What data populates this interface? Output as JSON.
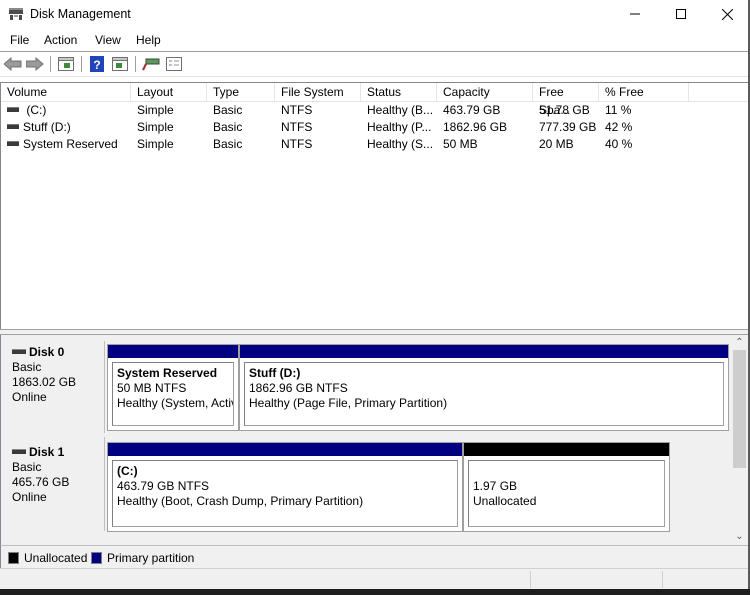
{
  "window": {
    "title": "Disk Management",
    "minimize": "minimize",
    "maximize": "maximize",
    "close": "close"
  },
  "menu": {
    "items": [
      {
        "label": "File"
      },
      {
        "label": "Action"
      },
      {
        "label": "View"
      },
      {
        "label": "Help"
      }
    ]
  },
  "toolbar": {
    "buttons": [
      "back-icon",
      "forward-icon",
      "show-hide-console-tree-icon",
      "help-icon",
      "show-hide-action-pane-icon",
      "connect-drive-icon",
      "properties-icon"
    ]
  },
  "volume_list": {
    "columns": [
      "Volume",
      "Layout",
      "Type",
      "File System",
      "Status",
      "Capacity",
      "Free Spa...",
      "% Free"
    ],
    "rows": [
      {
        "volume": " (C:)",
        "layout": "Simple",
        "type": "Basic",
        "fs": "NTFS",
        "status": "Healthy (B...",
        "capacity": "463.79 GB",
        "free": "51.78 GB",
        "pct": "11 %"
      },
      {
        "volume": "Stuff (D:)",
        "layout": "Simple",
        "type": "Basic",
        "fs": "NTFS",
        "status": "Healthy (P...",
        "capacity": "1862.96 GB",
        "free": "777.39 GB",
        "pct": "42 %"
      },
      {
        "volume": "System Reserved",
        "layout": "Simple",
        "type": "Basic",
        "fs": "NTFS",
        "status": "Healthy (S...",
        "capacity": "50 MB",
        "free": "20 MB",
        "pct": "40 %"
      }
    ]
  },
  "disks": [
    {
      "name": "Disk 0",
      "type": "Basic",
      "size": "1863.02 GB",
      "state": "Online",
      "partitions": [
        {
          "title": "System Reserved",
          "size": "50 MB NTFS",
          "status": "Healthy (System, Active, Primary Partition)",
          "kind": "primary"
        },
        {
          "title": "Stuff  (D:)",
          "size": "1862.96 GB NTFS",
          "status": "Healthy (Page File, Primary Partition)",
          "kind": "primary"
        }
      ]
    },
    {
      "name": "Disk 1",
      "type": "Basic",
      "size": "465.76 GB",
      "state": "Online",
      "partitions": [
        {
          "title": " (C:)",
          "size": "463.79 GB NTFS",
          "status": "Healthy (Boot, Crash Dump, Primary Partition)",
          "kind": "primary"
        },
        {
          "title": "",
          "size": "1.97 GB",
          "status": "Unallocated",
          "kind": "unallocated"
        }
      ]
    }
  ],
  "legend": [
    {
      "label": "Unallocated",
      "color": "#000000"
    },
    {
      "label": "Primary partition",
      "color": "#00007f"
    }
  ],
  "colors": {
    "primary": "#000080",
    "unallocated": "#000000"
  }
}
